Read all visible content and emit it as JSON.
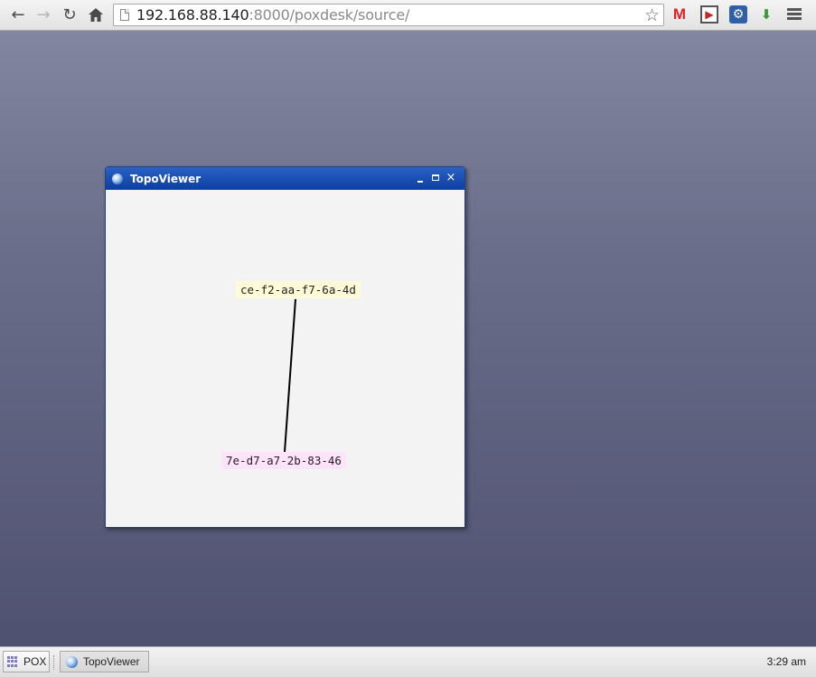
{
  "browser": {
    "back_icon": "arrow-left-icon",
    "forward_icon": "arrow-right-icon",
    "reload_icon": "reload-icon",
    "home_icon": "home-icon",
    "url_host": "192.168.88.140",
    "url_rest": ":8000/poxdesk/source/",
    "bookmark_icon": "star-outline-icon",
    "extensions": [
      {
        "name": "gmail-icon",
        "glyph": "M"
      },
      {
        "name": "film-icon",
        "glyph": "▶"
      },
      {
        "name": "gear-icon",
        "glyph": "⚙"
      },
      {
        "name": "plug-icon",
        "glyph": "⬇"
      }
    ],
    "menu_icon": "hamburger-menu-icon"
  },
  "window": {
    "title": "TopoViewer",
    "controls": {
      "minimize": "minimize-icon",
      "maximize": "maximize-icon",
      "close": "×"
    }
  },
  "topology": {
    "nodes": [
      {
        "id": "ce-f2-aa-f7-6a-4d",
        "color": "#fffbd9"
      },
      {
        "id": "7e-d7-a7-2b-83-46",
        "color": "#ffe3fa"
      }
    ],
    "links": [
      {
        "from": "ce-f2-aa-f7-6a-4d",
        "to": "7e-d7-a7-2b-83-46"
      }
    ]
  },
  "taskbar": {
    "start_label": "POX",
    "tasks": [
      {
        "label": "TopoViewer"
      }
    ],
    "clock": "3:29 am"
  },
  "colors": {
    "titlebar": "#1a4fb5",
    "desktop_top": "#82869f",
    "desktop_bottom": "#4f5170",
    "link": "#000000"
  }
}
